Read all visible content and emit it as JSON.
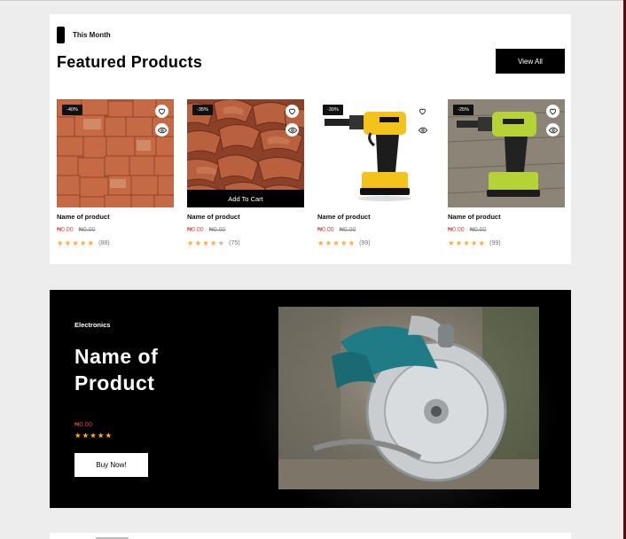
{
  "featured": {
    "eyebrow": "This Month",
    "title": "Featured Products",
    "view_all_label": "View All",
    "products": [
      {
        "discount": "-40%",
        "name": "Name of product",
        "price": "₦0.00",
        "old_price": "₦0.00",
        "rating": 5,
        "reviews": "(88)",
        "image": "bricks"
      },
      {
        "discount": "-35%",
        "name": "Name of product",
        "price": "₦0.00",
        "old_price": "₦0.00",
        "rating": 4,
        "reviews": "(75)",
        "image": "roof-tiles",
        "hover_action": "Add To Cart"
      },
      {
        "discount": "-30%",
        "name": "Name of product",
        "price": "₦0.00",
        "old_price": "₦0.00",
        "rating": 5,
        "reviews": "(99)",
        "image": "drill-yellow"
      },
      {
        "discount": "-25%",
        "name": "Name of product",
        "price": "₦0.00",
        "old_price": "₦0.00",
        "rating": 4.5,
        "reviews": "(99)",
        "image": "drill-green"
      }
    ]
  },
  "banner": {
    "category": "Electronics",
    "title": "Name of Product",
    "price": "₦0.00",
    "rating": 5,
    "cta_label": "Buy Now!",
    "image": "circular-saw"
  },
  "colors": {
    "accent": "#db4444",
    "star": "#ffad33",
    "dark": "#000000",
    "page_bg": "#ededed"
  },
  "icons": [
    "heart-icon",
    "eye-icon",
    "star-icon"
  ]
}
